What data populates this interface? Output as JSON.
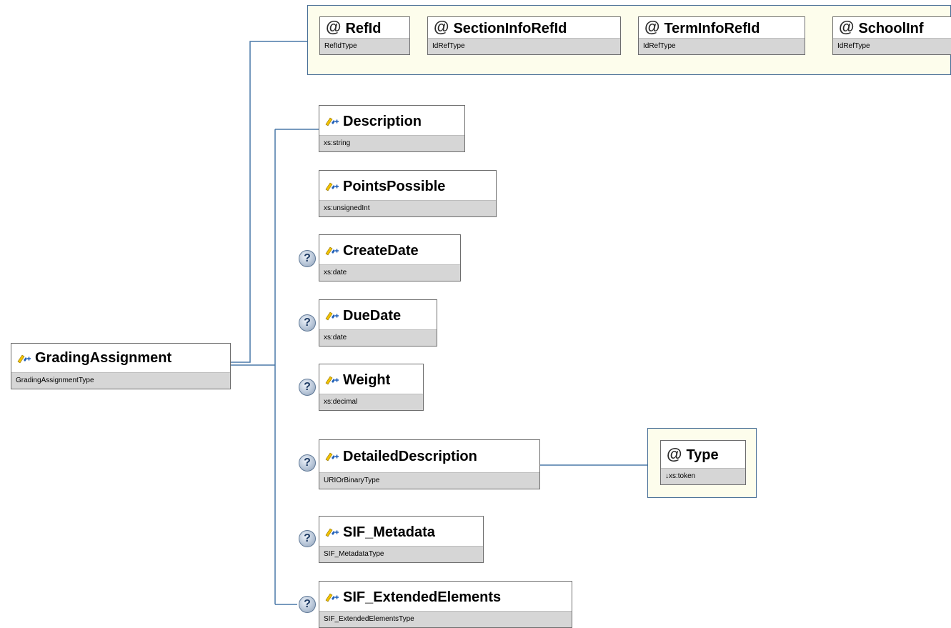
{
  "root": {
    "name": "GradingAssignment",
    "type": "GradingAssignmentType"
  },
  "attributes": [
    {
      "name": "RefId",
      "type": "RefIdType"
    },
    {
      "name": "SectionInfoRefId",
      "type": "IdRefType"
    },
    {
      "name": "TermInfoRefId",
      "type": "IdRefType"
    },
    {
      "name": "SchoolInf",
      "type": "IdRefType"
    }
  ],
  "elements": [
    {
      "name": "Description",
      "type": "xs:string",
      "optional": false
    },
    {
      "name": "PointsPossible",
      "type": "xs:unsignedInt",
      "optional": false
    },
    {
      "name": "CreateDate",
      "type": "xs:date",
      "optional": true
    },
    {
      "name": "DueDate",
      "type": "xs:date",
      "optional": true
    },
    {
      "name": "Weight",
      "type": "xs:decimal",
      "optional": true
    },
    {
      "name": "DetailedDescription",
      "type": "URIOrBinaryType",
      "optional": true
    },
    {
      "name": "SIF_Metadata",
      "type": "SIF_MetadataType",
      "optional": true
    },
    {
      "name": "SIF_ExtendedElements",
      "type": "SIF_ExtendedElementsType",
      "optional": true
    }
  ],
  "detailed_attribute": {
    "name": "Type",
    "type": "↓xs:token"
  },
  "optional_marker": "?",
  "attribute_marker": "@",
  "colors": {
    "wire": "#4a78a8",
    "attribute_group_bg": "#fdfdec",
    "type_bar": "#d6d6d6",
    "element_icon_yellow": "#f2c200",
    "element_icon_blue": "#1f5fb8"
  }
}
